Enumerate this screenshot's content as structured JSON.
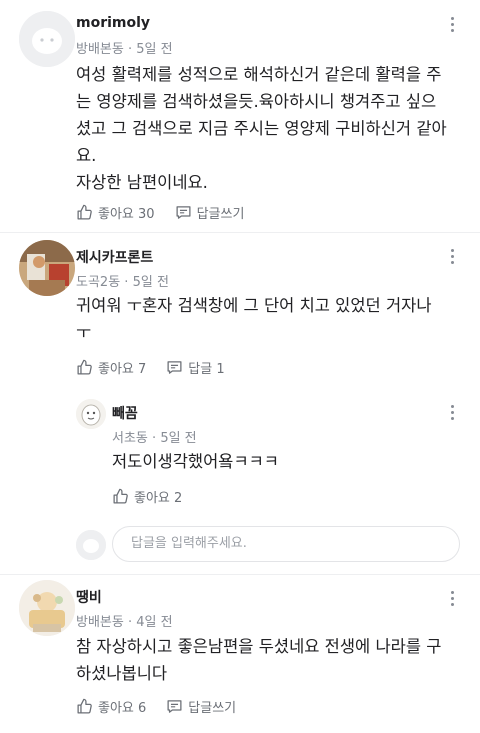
{
  "comments": [
    {
      "author": "morimoly",
      "location": "방배본동",
      "time": "5일 전",
      "text_lines": [
        "여성 활력제를 성적으로 해석하신거 같은데 활력을 주",
        "는 영양제를 검색하셨을듯.육아하시니 챙겨주고 싶으",
        "셨고 그 검색으로 지금 주시는 영양제 구비하신거 같아",
        "요.",
        "자상한 남편이네요."
      ],
      "like_label": "좋아요 30",
      "reply_label": "답글쓰기"
    },
    {
      "author": "제시카프론트",
      "location": "도곡2동",
      "time": "5일 전",
      "text_lines": [
        "귀여워 ㅜ혼자 검색창에 그 단어 치고 있었던 거자나",
        "ㅜ"
      ],
      "like_label": "좋아요 7",
      "reply_label": "답글 1"
    },
    {
      "author": "땡비",
      "location": "방배본동",
      "time": "4일 전",
      "text_lines": [
        "참 자상하시고 좋은남편을 두셨네요 전생에 나라를 구",
        "하셨나봅니다"
      ],
      "like_label": "좋아요 6",
      "reply_label": "답글쓰기"
    }
  ],
  "reply": {
    "author": "빼꼼",
    "location": "서초동",
    "time": "5일 전",
    "text": "저도이생각했어욬ㅋㅋㅋ",
    "like_label": "좋아요 2"
  },
  "reply_input": {
    "placeholder": "답글을 입력해주세요."
  },
  "meta_separator": "·"
}
